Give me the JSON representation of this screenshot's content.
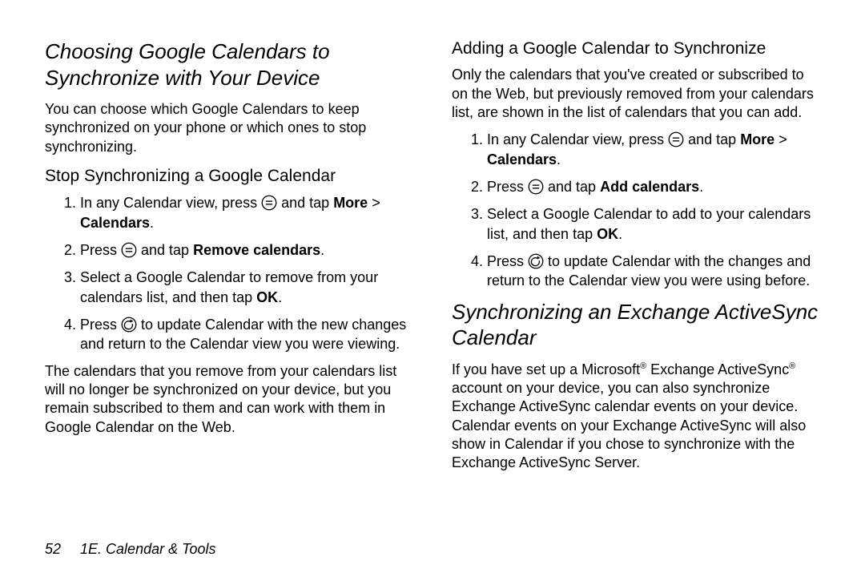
{
  "left": {
    "h2": "Choosing Google Calendars to Synchronize with Your Device",
    "intro": "You can choose which Google Calendars to keep synchronized on your phone or which ones to stop synchronizing.",
    "h3_stop": "Stop Synchronizing a Google Calendar",
    "stop": {
      "s1a": "In any Calendar view, press ",
      "s1b": " and tap ",
      "s1c": "More",
      "s1d": " > ",
      "s1e": "Calendars",
      "s1f": ".",
      "s2a": "Press ",
      "s2b": " and tap ",
      "s2c": "Remove calendars",
      "s2d": ".",
      "s3a": "Select a Google Calendar to remove from your calendars list, and then tap ",
      "s3b": "OK",
      "s3c": ".",
      "s4a": "Press ",
      "s4b": " to update Calendar with the new changes and return to the Calendar view you were viewing."
    },
    "after": "The calendars that you remove from your calendars list will no longer be synchronized on your device, but you remain subscribed to them and can work with them in Google Calendar on the Web."
  },
  "right": {
    "h3_add": "Adding a Google Calendar to Synchronize",
    "add_intro": "Only the calendars that you've created or subscribed to on the Web, but previously removed from your calendars list, are shown in the list of calendars that you can add.",
    "add": {
      "s1a": "In any Calendar view, press ",
      "s1b": " and tap ",
      "s1c": "More",
      "s1d": " > ",
      "s1e": "Calendars",
      "s1f": ".",
      "s2a": "Press ",
      "s2b": " and tap ",
      "s2c": "Add calendars",
      "s2d": ".",
      "s3a": "Select a Google Calendar to add to your calendars list, and then tap ",
      "s3b": "OK",
      "s3c": ".",
      "s4a": "Press ",
      "s4b": " to update Calendar with the changes and return to the Calendar view you were using before."
    },
    "h2_sync": "Synchronizing an Exchange ActiveSync Calendar",
    "sync_p1a": "If you have set up a Microsoft",
    "sync_p1b": " Exchange ActiveSync",
    "sync_p1c": " account on your device, you can also synchronize Exchange ActiveSync calendar events on your device. Calendar events on your Exchange ActiveSync will also show in Calendar if you chose to synchronize with the Exchange ActiveSync Server."
  },
  "footer": {
    "page": "52",
    "section": "1E. Calendar & Tools"
  },
  "glyphs": {
    "reg": "®"
  }
}
